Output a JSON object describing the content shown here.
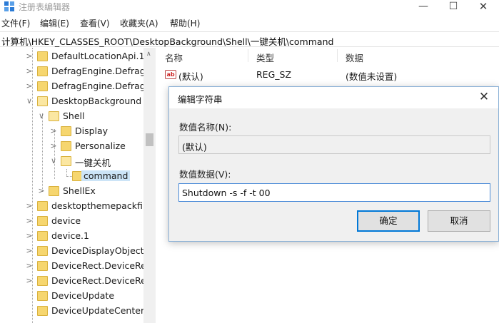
{
  "window": {
    "title": "注册表编辑器",
    "controls": {
      "minimize": "—",
      "maximize": "☐",
      "close": "✕"
    }
  },
  "menu": {
    "items": [
      {
        "label": "文件(F)"
      },
      {
        "label": "编辑(E)"
      },
      {
        "label": "查看(V)"
      },
      {
        "label": "收藏夹(A)"
      },
      {
        "label": "帮助(H)"
      }
    ]
  },
  "address": {
    "path": "计算机\\HKEY_CLASSES_ROOT\\DesktopBackground\\Shell\\一键关机\\command"
  },
  "tree": {
    "items": [
      {
        "label": "DefaultLocationApi.1",
        "chevron": ">"
      },
      {
        "label": "DefragEngine.Defrag",
        "chevron": ">"
      },
      {
        "label": "DefragEngine.Defrag",
        "chevron": ">"
      },
      {
        "label": "DesktopBackground",
        "chevron": "∨"
      },
      {
        "label": "Shell",
        "chevron": "∨"
      },
      {
        "label": "Display",
        "chevron": ">"
      },
      {
        "label": "Personalize",
        "chevron": ">"
      },
      {
        "label": "一键关机",
        "chevron": "∨"
      },
      {
        "label": "command",
        "chevron": ""
      },
      {
        "label": "ShellEx",
        "chevron": ">"
      },
      {
        "label": "desktopthemepackfil",
        "chevron": ">"
      },
      {
        "label": "device",
        "chevron": ">"
      },
      {
        "label": "device.1",
        "chevron": ">"
      },
      {
        "label": "DeviceDisplayObject",
        "chevron": ">"
      },
      {
        "label": "DeviceRect.DeviceRec",
        "chevron": ">"
      },
      {
        "label": "DeviceRect.DeviceRec",
        "chevron": ">"
      },
      {
        "label": "DeviceUpdate",
        "chevron": ""
      },
      {
        "label": "DeviceUpdateCenter",
        "chevron": ""
      }
    ],
    "scroll_up": "∧"
  },
  "list": {
    "columns": {
      "name": "名称",
      "type": "类型",
      "data": "数据"
    },
    "rows": [
      {
        "icon": "ab",
        "name": "(默认)",
        "type": "REG_SZ",
        "data": "(数值未设置)"
      }
    ]
  },
  "dialog": {
    "title": "编辑字符串",
    "close": "✕",
    "name_label": "数值名称(N):",
    "name_value": "(默认)",
    "data_label": "数值数据(V):",
    "data_value": "Shutdown -s -f -t 00",
    "ok_label": "确定",
    "cancel_label": "取消"
  },
  "colors": {
    "accent": "#0078d7",
    "folder": "#f6d66f",
    "selection": "#cce4f7"
  }
}
